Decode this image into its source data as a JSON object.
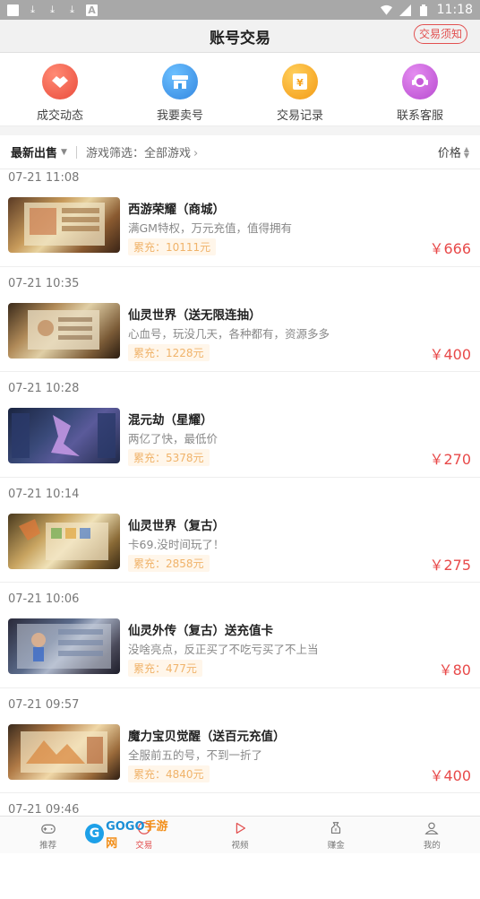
{
  "status_bar": {
    "time": "11:18"
  },
  "header": {
    "title": "账号交易",
    "notice_button": "交易须知"
  },
  "quick_actions": [
    {
      "label": "成交动态",
      "icon": "handshake-icon",
      "color": "#ef5a4a"
    },
    {
      "label": "我要卖号",
      "icon": "shop-icon",
      "color": "#3b9ae8"
    },
    {
      "label": "交易记录",
      "icon": "yen-record-icon",
      "color": "#f6a21c"
    },
    {
      "label": "联系客服",
      "icon": "support-icon",
      "color": "#c65ad8"
    }
  ],
  "filter": {
    "sort_label": "最新出售",
    "game_filter": "游戏筛选：全部游戏",
    "price_label": "价格"
  },
  "listings": [
    {
      "date": "07-21 11:08",
      "title": "西游荣耀（商城）",
      "desc": "满GM特权，万元充值，值得拥有",
      "total": "累充：10111元",
      "price": "￥666"
    },
    {
      "date": "07-21 10:35",
      "title": "仙灵世界（送无限连抽）",
      "desc": "心血号，玩没几天，各种都有，资源多多",
      "total": "累充：1228元",
      "price": "￥400"
    },
    {
      "date": "07-21 10:28",
      "title": "混元劫（星耀）",
      "desc": "两亿了快，最低价",
      "total": "累充：5378元",
      "price": "￥270"
    },
    {
      "date": "07-21 10:14",
      "title": "仙灵世界（复古）",
      "desc": "卡69.没时间玩了！",
      "total": "累充：2858元",
      "price": "￥275"
    },
    {
      "date": "07-21 10:06",
      "title": "仙灵外传（复古）送充值卡",
      "desc": "没啥亮点，反正买了不吃亏买了不上当",
      "total": "累充：477元",
      "price": "￥80"
    },
    {
      "date": "07-21 09:57",
      "title": "魔力宝贝觉醒（送百元充值）",
      "desc": "全服前五的号，不到一折了",
      "total": "累充：4840元",
      "price": "￥400"
    },
    {
      "date": "07-21 09:46",
      "title": "",
      "desc": "",
      "total": "",
      "price": ""
    }
  ],
  "tab_bar": [
    {
      "label": "推荐",
      "icon": "gamepad-icon"
    },
    {
      "label": "交易",
      "icon": "trade-icon"
    },
    {
      "label": "视频",
      "icon": "play-icon"
    },
    {
      "label": "赚金",
      "icon": "coin-bag-icon"
    },
    {
      "label": "我的",
      "icon": "user-icon"
    }
  ],
  "watermark": {
    "brand": "GOGO",
    "suffix": "手游网"
  }
}
